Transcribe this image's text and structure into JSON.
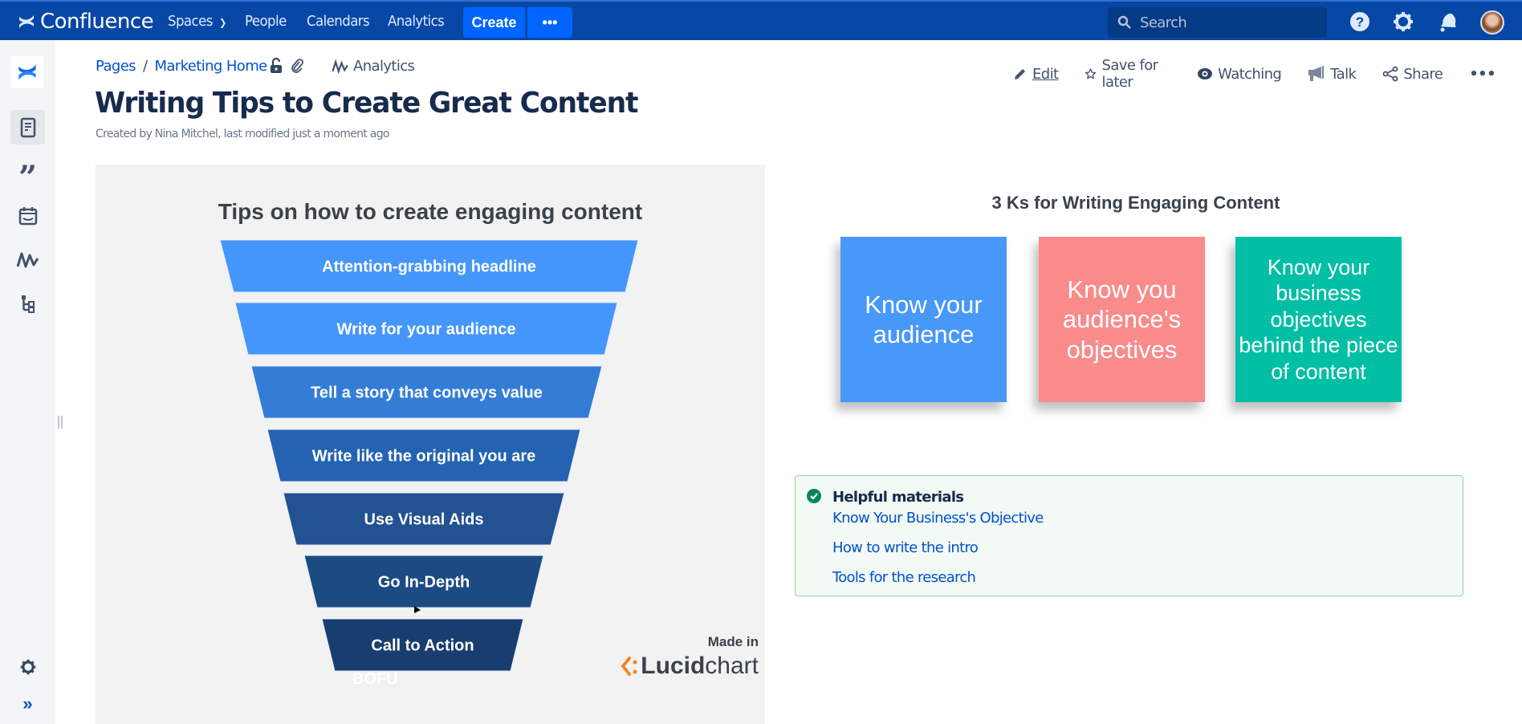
{
  "app": {
    "name": "Confluence"
  },
  "topnav": {
    "items": [
      {
        "label": "Spaces",
        "has_dropdown": true
      },
      {
        "label": "People"
      },
      {
        "label": "Calendars"
      },
      {
        "label": "Analytics"
      }
    ],
    "create_label": "Create",
    "more_label": "•••",
    "search_placeholder": "Search",
    "icons": [
      "help-icon",
      "settings-icon",
      "notifications-icon"
    ]
  },
  "sidebar": {
    "items": [
      {
        "name": "pages",
        "icon": "pages-icon",
        "active": true
      },
      {
        "name": "blog",
        "icon": "quote-icon"
      },
      {
        "name": "calendars",
        "icon": "calendar-icon"
      },
      {
        "name": "analytics",
        "icon": "analytics-icon"
      },
      {
        "name": "page-tree",
        "icon": "hierarchy-icon"
      }
    ],
    "bottom": [
      "settings-icon",
      "expand-icon"
    ]
  },
  "breadcrumb": {
    "items": [
      "Pages",
      "Marketing Home"
    ],
    "separator": "/",
    "analytics_label": "Analytics"
  },
  "actions": [
    {
      "label": "Edit",
      "icon": "pencil-icon",
      "accesskey": "E"
    },
    {
      "label": "Save for later",
      "icon": "star-icon"
    },
    {
      "label": "Watching",
      "icon": "eye-icon"
    },
    {
      "label": "Talk",
      "icon": "megaphone-icon"
    },
    {
      "label": "Share",
      "icon": "share-icon"
    },
    {
      "label": "•••",
      "icon": "more-icon"
    }
  ],
  "page": {
    "title": "Writing Tips to Create Great Content",
    "byline": "Created by Nina Mitchel, last modified just a moment ago"
  },
  "funnel": {
    "title": "Tips on how to create engaging content",
    "steps": [
      {
        "label": "Attention-grabbing headline",
        "color": "#4596fa"
      },
      {
        "label": "Write for your audience",
        "color": "#4596fa"
      },
      {
        "label": "Tell a story that conveys value",
        "color": "#347dd6"
      },
      {
        "label": "Write like the original you are",
        "color": "#2363b1"
      },
      {
        "label": "Use Visual Aids",
        "color": "#225292"
      },
      {
        "label": "Go In-Depth",
        "color": "#1c4a83"
      },
      {
        "label": "Call to Action",
        "color": "#193d6e"
      }
    ],
    "bofu_label": "BOFU",
    "made_in": "Made in",
    "brand_bold": "Lucid",
    "brand_light": "chart"
  },
  "ks": {
    "title": "3 Ks for Writing Engaging Content",
    "notes": [
      {
        "text": "Know your audience",
        "color": "#4898f9"
      },
      {
        "text": "Know you audience's objectives",
        "color": "#fa8b8b"
      },
      {
        "text": "Know your business objectives behind the piece of content",
        "color": "#00bfa5"
      }
    ]
  },
  "helpful": {
    "title": "Helpful materials",
    "links": [
      "Know Your Business's Objective",
      "How to write the intro",
      "Tools for the research"
    ]
  },
  "colors": {
    "topbar": "#0747a6",
    "create": "#0065ff",
    "link": "#0052cc"
  }
}
